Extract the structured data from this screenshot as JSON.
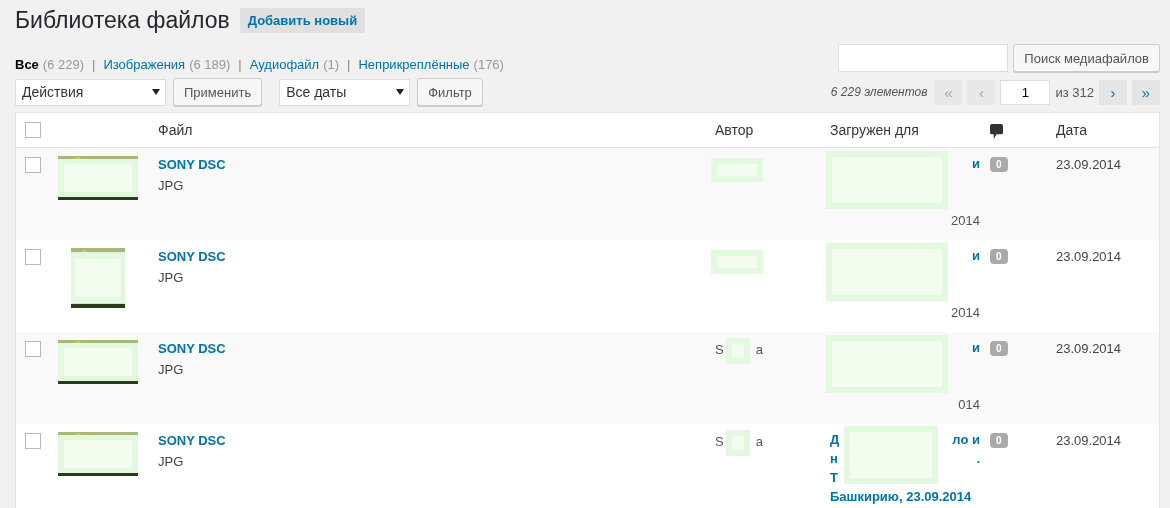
{
  "page_title": "Библиотека файлов",
  "add_new_button": "Добавить новый",
  "separator": "|",
  "filters": [
    {
      "label": "Все",
      "count": "(6 229)",
      "selected": true
    },
    {
      "label": "Изображения",
      "count": "(6 189)",
      "selected": false
    },
    {
      "label": "Аудиофайл",
      "count": "(1)",
      "selected": false
    },
    {
      "label": "Неприкреплённые",
      "count": "(176)",
      "selected": false
    }
  ],
  "search": {
    "button": "Поиск медиафайлов"
  },
  "bulk_actions": {
    "value": "Действия",
    "apply": "Применить"
  },
  "date_filter": {
    "value": "Все даты",
    "button": "Фильтр"
  },
  "pagination": {
    "count": "6 229 элементов",
    "first": "«",
    "prev": "‹",
    "page": "1",
    "of": "из 312",
    "next": "›",
    "last": "»"
  },
  "table": {
    "select_all_checked": false,
    "columns": [
      "Файл",
      "Автор",
      "Загружен для",
      "Дата"
    ],
    "rows": [
      {
        "checked": false,
        "title": "SONY DSC",
        "type": "JPG",
        "author": {},
        "uploaded_to": [
          {
            "kind": "top",
            "text": "и"
          },
          {
            "kind": "bottom",
            "text": "2014"
          }
        ],
        "comments": "0",
        "date": "23.09.2014"
      },
      {
        "checked": false,
        "title": "SONY DSC",
        "type": "JPG",
        "author": {},
        "uploaded_to": [
          {
            "kind": "top",
            "text": "и"
          },
          {
            "kind": "bottom",
            "text": "2014"
          }
        ],
        "comments": "0",
        "date": "23.09.2014"
      },
      {
        "checked": false,
        "title": "SONY DSC",
        "type": "JPG",
        "author": {
          "start": "S",
          "end": "a"
        },
        "uploaded_to": [
          {
            "kind": "top",
            "text": "и"
          },
          {
            "kind": "bottom",
            "text": "014"
          }
        ],
        "comments": "0",
        "date": "23.09.2014"
      },
      {
        "checked": false,
        "title": "SONY DSC",
        "type": "JPG",
        "author": {
          "start": "S",
          "end": "a"
        },
        "uploaded_to": [
          {
            "kind": "line",
            "start": "Д",
            "end": "ло и"
          },
          {
            "kind": "line",
            "start": "н",
            "end": "."
          },
          {
            "kind": "line",
            "start": "Т"
          },
          {
            "kind": "line",
            "start": "**Башкирию**, 23.09.2014"
          }
        ],
        "comments": "0",
        "date": "23.09.2014"
      }
    ]
  }
}
